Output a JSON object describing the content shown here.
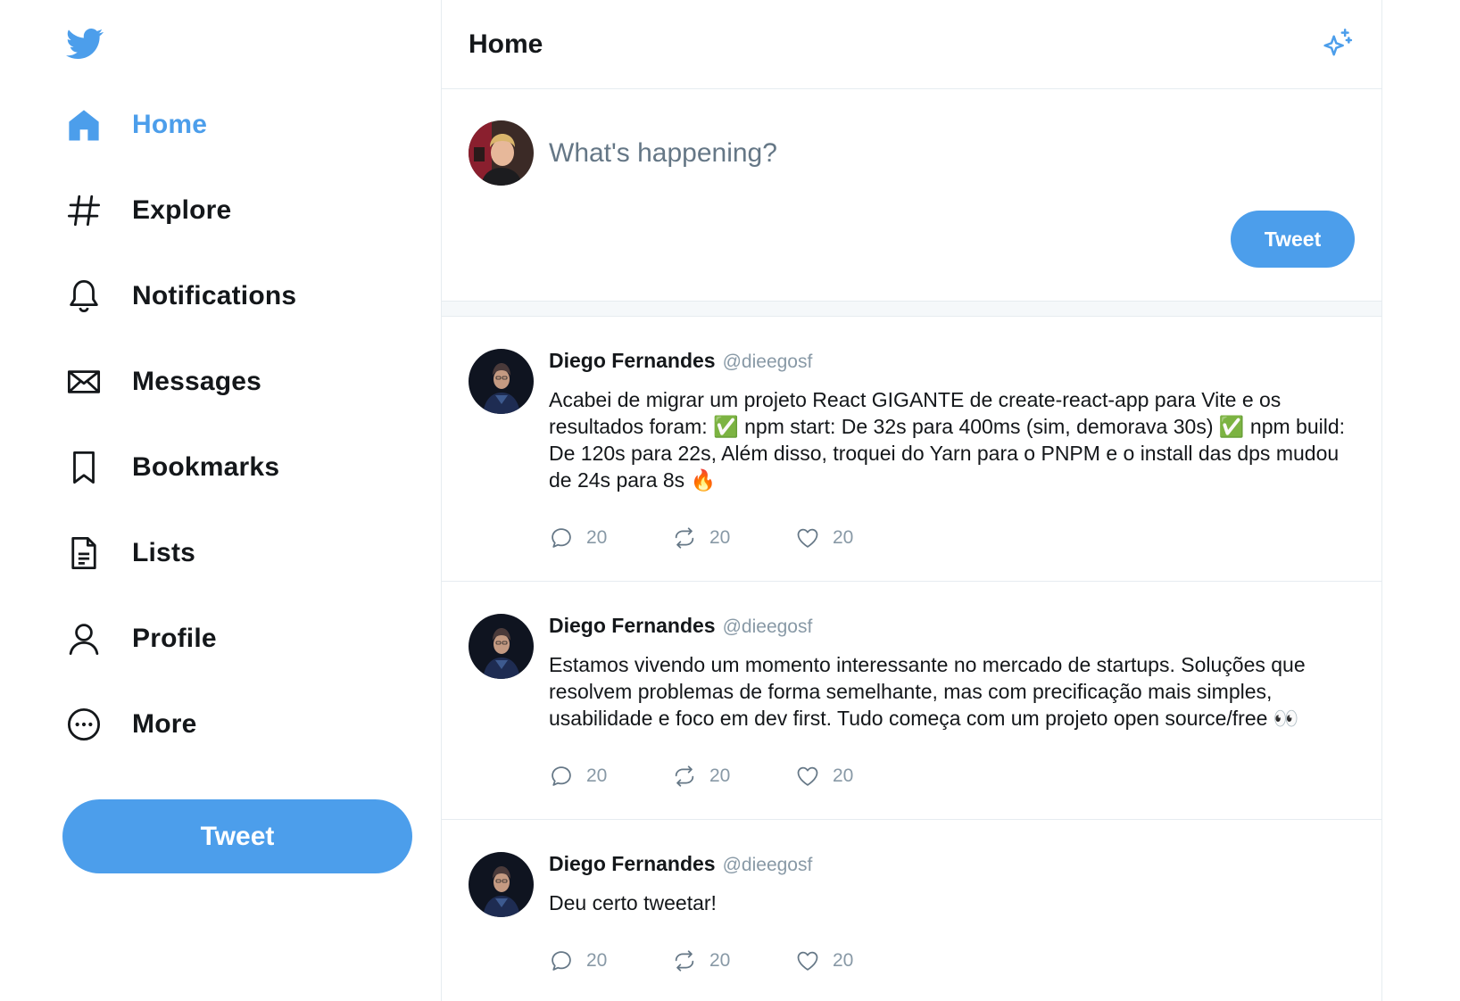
{
  "brand": {
    "color": "#4c9eeb",
    "logo_icon": "twitter-bird-icon"
  },
  "sidebar": {
    "items": [
      {
        "label": "Home",
        "icon": "home-icon",
        "active": true
      },
      {
        "label": "Explore",
        "icon": "hashtag-icon"
      },
      {
        "label": "Notifications",
        "icon": "bell-icon"
      },
      {
        "label": "Messages",
        "icon": "envelope-icon"
      },
      {
        "label": "Bookmarks",
        "icon": "bookmark-icon"
      },
      {
        "label": "Lists",
        "icon": "list-document-icon"
      },
      {
        "label": "Profile",
        "icon": "user-icon"
      },
      {
        "label": "More",
        "icon": "more-circle-icon"
      }
    ],
    "tweet_button": "Tweet"
  },
  "header": {
    "title": "Home",
    "icon": "sparkle-icon"
  },
  "composer": {
    "placeholder": "What's happening?",
    "tweet_button": "Tweet"
  },
  "tweets": [
    {
      "author": "Diego Fernandes",
      "handle": "@dieegosf",
      "text": "Acabei de migrar um projeto React GIGANTE de create-react-app para Vite e os resultados foram: ✅ npm start: De 32s para 400ms (sim, demorava 30s) ✅ npm build: De 120s para 22s, Além disso, troquei do Yarn para o PNPM e o install das dps mudou de 24s para 8s 🔥",
      "comments": "20",
      "retweets": "20",
      "likes": "20"
    },
    {
      "author": "Diego Fernandes",
      "handle": "@dieegosf",
      "text": "Estamos vivendo um momento interessante no mercado de startups. Soluções que resolvem problemas de forma semelhante, mas com precificação mais simples, usabilidade e foco em dev first. Tudo começa com um projeto open source/free 👀",
      "comments": "20",
      "retweets": "20",
      "likes": "20"
    },
    {
      "author": "Diego Fernandes",
      "handle": "@dieegosf",
      "text": "Deu certo tweetar!",
      "comments": "20",
      "retweets": "20",
      "likes": "20"
    }
  ]
}
